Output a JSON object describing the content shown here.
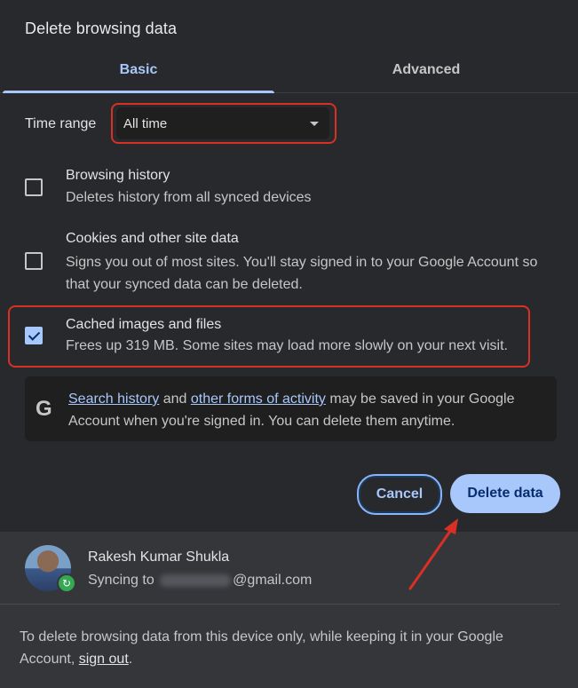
{
  "dialog": {
    "title": "Delete browsing data"
  },
  "tabs": [
    {
      "label": "Basic",
      "active": true
    },
    {
      "label": "Advanced",
      "active": false
    }
  ],
  "time_range": {
    "label": "Time range",
    "value": "All time"
  },
  "options": [
    {
      "title": "Browsing history",
      "description": "Deletes history from all synced devices",
      "checked": false
    },
    {
      "title": "Cookies and other site data",
      "description": "Signs you out of most sites. You'll stay signed in to your Google Account so that your synced data can be deleted.",
      "checked": false
    },
    {
      "title": "Cached images and files",
      "description": "Frees up 319 MB. Some sites may load more slowly on your next visit.",
      "checked": true
    }
  ],
  "info": {
    "icon": "google-g-icon",
    "link1": "Search history",
    "mid": "and",
    "link2": "other forms of activity",
    "rest": "may be saved in your Google Account when you're signed in. You can delete them anytime."
  },
  "buttons": {
    "cancel": "Cancel",
    "delete": "Delete data"
  },
  "account": {
    "name": "Rakesh Kumar Shukla",
    "sync_prefix": "Syncing to",
    "email_domain": "@gmail.com",
    "badge_icon": "sync-icon"
  },
  "footer": {
    "note": "To delete browsing data from this device only, while keeping it in your Google Account,",
    "link": "sign out",
    "end": "."
  },
  "colors": {
    "accent": "#a8c7fa",
    "annotation": "#d93025",
    "background": "#28292c"
  }
}
